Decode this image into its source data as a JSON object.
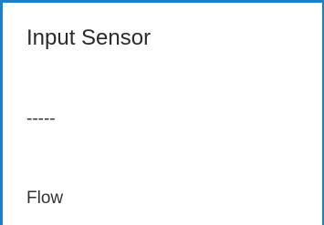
{
  "dialog": {
    "title": "Input Sensor",
    "options": [
      {
        "label": "-----"
      },
      {
        "label": "Flow"
      }
    ]
  },
  "colors": {
    "border_accent": "#1f7fc6",
    "text": "#333333",
    "title_text": "#2b2b2b",
    "background": "#ffffff"
  }
}
